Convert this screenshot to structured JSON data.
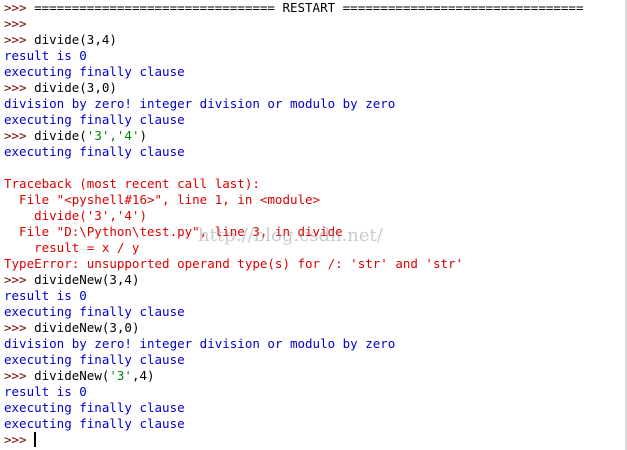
{
  "prompt": ">>>",
  "restart_line": "================================ RESTART ================================",
  "watermark": "http://blog.csdn.net/",
  "lines": [
    {
      "kind": "restart"
    },
    {
      "kind": "prompt-empty"
    },
    {
      "kind": "cmd",
      "text": "divide(3,4)"
    },
    {
      "kind": "out",
      "text": "result is 0"
    },
    {
      "kind": "out",
      "text": "executing finally clause"
    },
    {
      "kind": "cmd",
      "text": "divide(3,0)"
    },
    {
      "kind": "out",
      "text": "division by zero! integer division or modulo by zero"
    },
    {
      "kind": "out",
      "text": "executing finally clause"
    },
    {
      "kind": "cmd-str",
      "pre": "divide(",
      "str": "'3','4'",
      "post": ")"
    },
    {
      "kind": "out",
      "text": "executing finally clause"
    },
    {
      "kind": "blank"
    },
    {
      "kind": "err",
      "text": "Traceback (most recent call last):"
    },
    {
      "kind": "err",
      "text": "  File \"<pyshell#16>\", line 1, in <module>"
    },
    {
      "kind": "err",
      "text": "    divide('3','4')"
    },
    {
      "kind": "err",
      "text": "  File \"D:\\Python\\test.py\", line 3, in divide"
    },
    {
      "kind": "err",
      "text": "    result = x / y"
    },
    {
      "kind": "err",
      "text": "TypeError: unsupported operand type(s) for /: 'str' and 'str'"
    },
    {
      "kind": "cmd",
      "text": "divideNew(3,4)"
    },
    {
      "kind": "out",
      "text": "result is 0"
    },
    {
      "kind": "out",
      "text": "executing finally clause"
    },
    {
      "kind": "cmd",
      "text": "divideNew(3,0)"
    },
    {
      "kind": "out",
      "text": "division by zero! integer division or modulo by zero"
    },
    {
      "kind": "out",
      "text": "executing finally clause"
    },
    {
      "kind": "cmd-str",
      "pre": "divideNew(",
      "str": "'3'",
      "post": ",4)"
    },
    {
      "kind": "out",
      "text": "result is 0"
    },
    {
      "kind": "out",
      "text": "executing finally clause"
    },
    {
      "kind": "out",
      "text": "executing finally clause"
    },
    {
      "kind": "cursor"
    }
  ]
}
